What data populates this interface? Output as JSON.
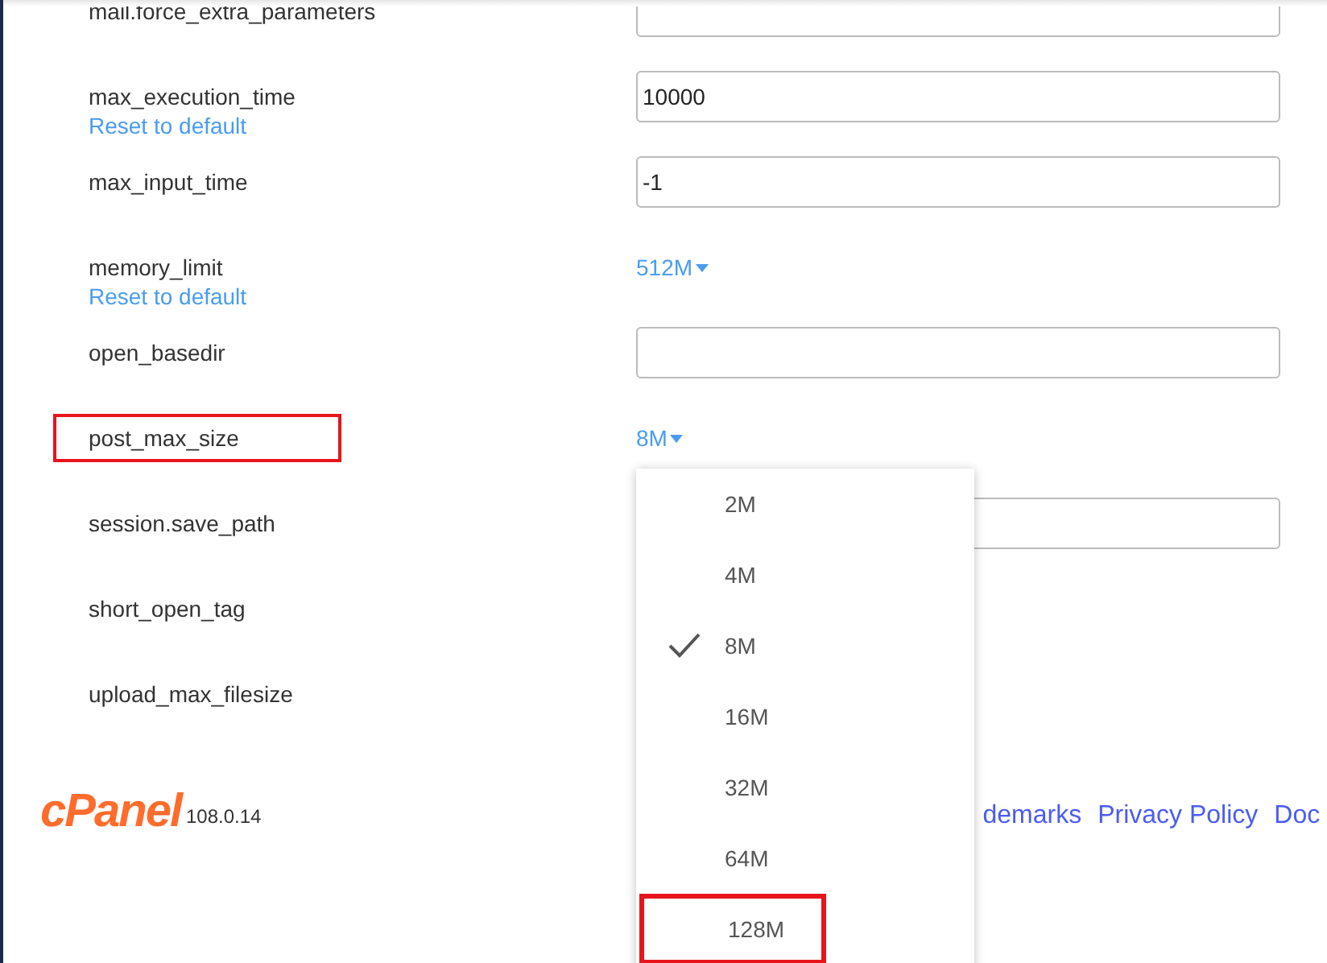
{
  "settings": [
    {
      "name": "mail.force_extra_parameters",
      "highlighted": false,
      "control": {
        "kind": "text"
      }
    },
    {
      "name": "max_execution_time",
      "highlighted": false,
      "reset": "Reset to default",
      "control": {
        "kind": "text",
        "value": "10000"
      }
    },
    {
      "name": "max_input_time",
      "highlighted": false,
      "control": {
        "kind": "text",
        "value": "-1"
      }
    },
    {
      "name": "memory_limit",
      "highlighted": false,
      "reset": "Reset to default",
      "control": {
        "kind": "select",
        "value": "512M"
      }
    },
    {
      "name": "open_basedir",
      "highlighted": false,
      "control": {
        "kind": "text"
      }
    },
    {
      "name": "post_max_size",
      "highlighted": true,
      "control": {
        "kind": "select",
        "value": "8M",
        "expanded": true
      }
    },
    {
      "name": "session.save_path",
      "highlighted": false,
      "control": {
        "kind": "text"
      }
    },
    {
      "name": "short_open_tag",
      "highlighted": false
    },
    {
      "name": "upload_max_filesize",
      "highlighted": false
    }
  ],
  "menu": {
    "options": [
      {
        "label": "2M",
        "selected": false,
        "highlighted": false
      },
      {
        "label": "4M",
        "selected": false,
        "highlighted": false
      },
      {
        "label": "8M",
        "selected": true,
        "highlighted": false
      },
      {
        "label": "16M",
        "selected": false,
        "highlighted": false
      },
      {
        "label": "32M",
        "selected": false,
        "highlighted": false
      },
      {
        "label": "64M",
        "selected": false,
        "highlighted": false
      },
      {
        "label": "128M",
        "selected": false,
        "highlighted": true
      }
    ]
  },
  "footer": {
    "logo": "cPanel",
    "version": "108.0.14",
    "links": [
      "demarks",
      "Privacy Policy",
      "Doc"
    ]
  }
}
